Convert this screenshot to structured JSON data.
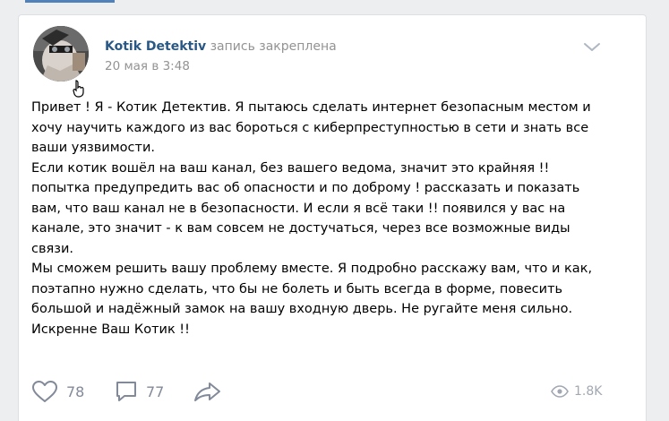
{
  "post": {
    "author": "Kotik Detektiv",
    "pinned_note": "запись закреплена",
    "date": "20 мая в 3:48",
    "paragraphs": [
      "Привет ! Я - Котик Детектив. Я пытаюсь сделать интернет безопасным местом и",
      "хочу научить каждого из вас бороться с киберпреступностью в сети и знать все",
      "ваши уязвимости.",
      "Если котик вошёл на ваш канал, без вашего ведома, значит это крайняя !!",
      "попытка предупредить вас об опасности и по доброму ! рассказать и показать",
      "вам, что ваш канал не в безопасности. И если я всё таки !! появился у вас на",
      "канале, это значит - к вам совсем не достучаться, через все возможные виды",
      "связи.",
      "Мы сможем решить вашу проблему вместе. Я подробно расскажу вам, что и как,",
      "поэтапно нужно сделать, что бы не болеть и быть всегда в форме, повесить",
      "большой и надёжный замок на вашу входную дверь. Не ругайте меня сильно.",
      "Искренне Ваш Котик !!"
    ],
    "likes": "78",
    "comments": "77",
    "views": "1.8K"
  },
  "icons": {
    "like": "heart-icon",
    "comment": "comment-icon",
    "share": "share-arrow-icon",
    "views": "eye-icon",
    "more": "chevron-down-icon"
  },
  "colors": {
    "link": "#2a5885",
    "meta": "#939393",
    "action": "#828a99",
    "accent": "#5181b8"
  }
}
